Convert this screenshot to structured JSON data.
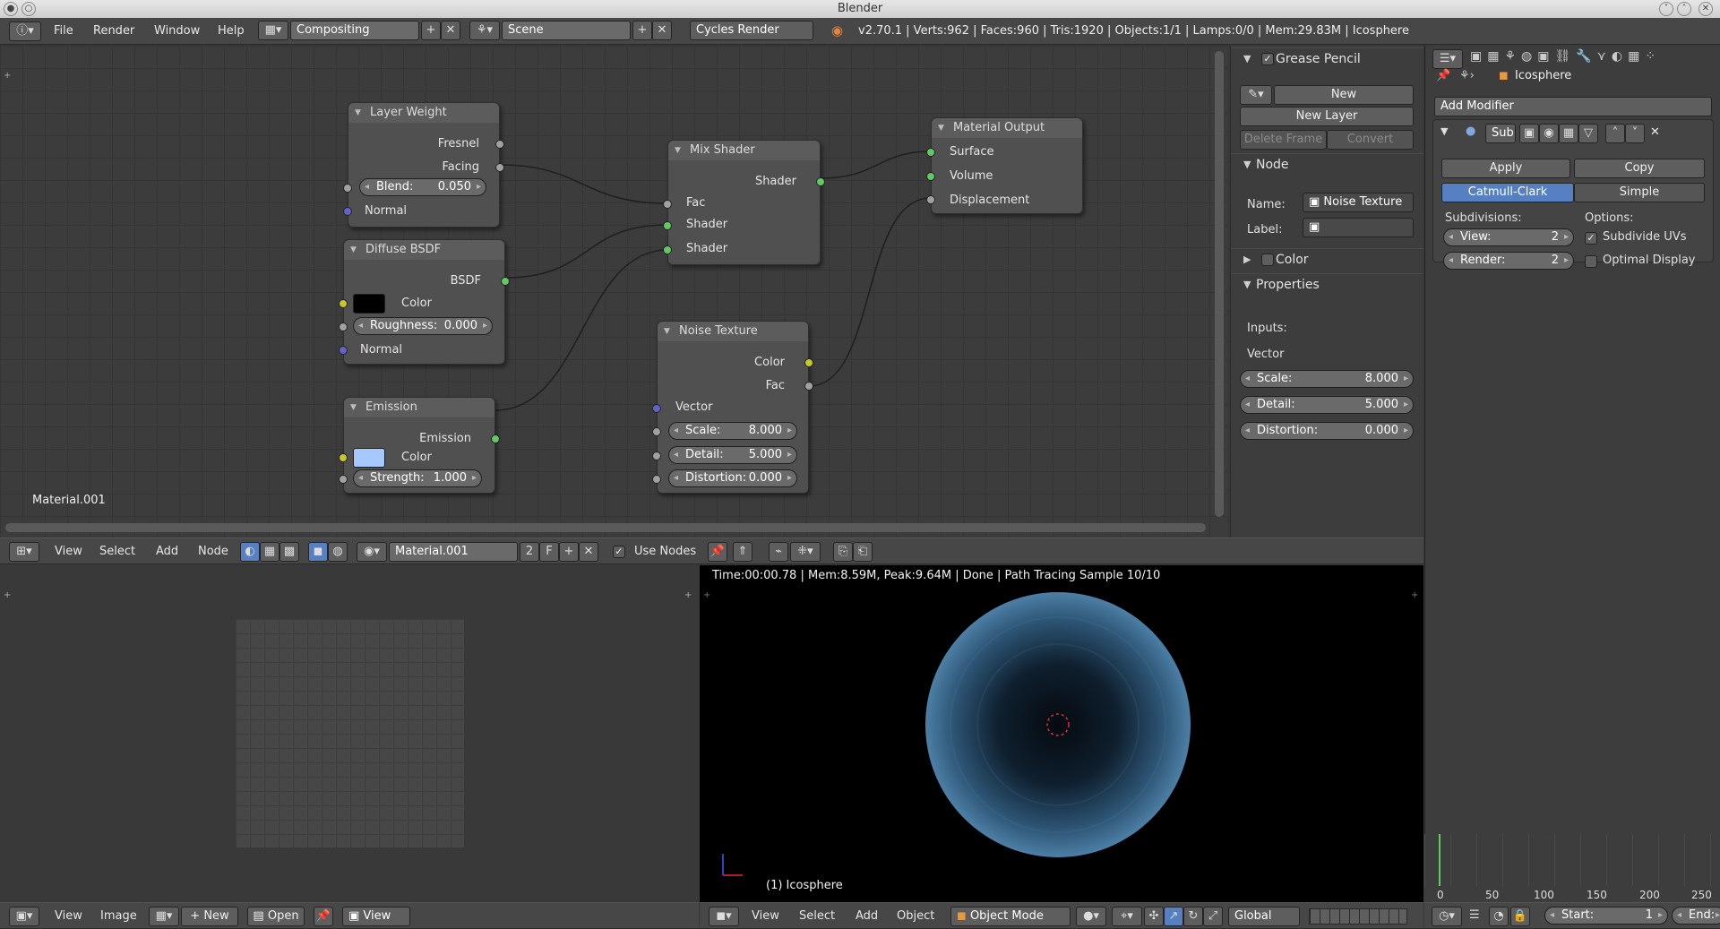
{
  "window": {
    "title": "Blender"
  },
  "topbar": {
    "menus": [
      "File",
      "Render",
      "Window",
      "Help"
    ],
    "screen_layout": "Compositing",
    "scene": "Scene",
    "render_engine": "Cycles Render",
    "stats": "v2.70.1 | Verts:962 | Faces:960 | Tris:1920 | Objects:1/1 | Lamps:0/0 | Mem:29.83M | Icosphere"
  },
  "node_editor": {
    "material_label": "Material.001",
    "nodes": {
      "layer_weight": {
        "title": "Layer Weight",
        "out1": "Fresnel",
        "out2": "Facing",
        "blend_label": "Blend:",
        "blend_value": "0.050",
        "in_normal": "Normal"
      },
      "diffuse": {
        "title": "Diffuse BSDF",
        "out": "BSDF",
        "color_label": "Color",
        "color": "#000000",
        "rough_label": "Roughness:",
        "rough_value": "0.000",
        "in_normal": "Normal"
      },
      "emission": {
        "title": "Emission",
        "out": "Emission",
        "color_label": "Color",
        "color": "#a5c8ff",
        "strength_label": "Strength:",
        "strength_value": "1.000"
      },
      "mix": {
        "title": "Mix Shader",
        "out": "Shader",
        "in_fac": "Fac",
        "in1": "Shader",
        "in2": "Shader"
      },
      "noise": {
        "title": "Noise Texture",
        "out_color": "Color",
        "out_fac": "Fac",
        "in_vector": "Vector",
        "scale_label": "Scale:",
        "scale_value": "8.000",
        "detail_label": "Detail:",
        "detail_value": "5.000",
        "distortion_label": "Distortion:",
        "distortion_value": "0.000"
      },
      "output": {
        "title": "Material Output",
        "in_surface": "Surface",
        "in_volume": "Volume",
        "in_displacement": "Displacement"
      }
    }
  },
  "node_props": {
    "grease_pencil": "Grease Pencil",
    "new": "New",
    "new_layer": "New Layer",
    "delete_frame": "Delete Frame",
    "convert": "Convert",
    "node_section": "Node",
    "name_label": "Name:",
    "name_value": "Noise Texture",
    "label_label": "Label:",
    "color_section": "Color",
    "properties_section": "Properties",
    "inputs": "Inputs:",
    "vector": "Vector",
    "scale_label": "Scale:",
    "scale_value": "8.000",
    "detail_label": "Detail:",
    "detail_value": "5.000",
    "distortion_label": "Distortion:",
    "distortion_value": "0.000"
  },
  "node_header": {
    "menus": [
      "View",
      "Select",
      "Add",
      "Node"
    ],
    "material": "Material.001",
    "users": "2",
    "fake": "F",
    "use_nodes": "Use Nodes"
  },
  "modifiers": {
    "object": "Icosphere",
    "add_modifier": "Add Modifier",
    "mod_name": "Sub",
    "apply": "Apply",
    "copy": "Copy",
    "catmull": "Catmull-Clark",
    "simple": "Simple",
    "subdivisions": "Subdivisions:",
    "options": "Options:",
    "view_label": "View:",
    "view_value": "2",
    "render_label": "Render:",
    "render_value": "2",
    "subdivide_uvs": "Subdivide UVs",
    "optimal_display": "Optimal Display"
  },
  "image_header": {
    "menus": [
      "View",
      "Image"
    ],
    "new": "New",
    "open": "Open",
    "view": "View"
  },
  "viewport": {
    "render_info": "Time:00:00.78 | Mem:8.59M, Peak:9.64M | Done | Path Tracing Sample 10/10",
    "object_label": "(1) Icosphere",
    "menus": [
      "View",
      "Select",
      "Add",
      "Object"
    ],
    "mode": "Object Mode",
    "orientation": "Global"
  },
  "timeline": {
    "ticks": [
      "0",
      "50",
      "100",
      "150",
      "200",
      "250"
    ],
    "start_label": "Start:",
    "start_value": "1",
    "end_label": "End:"
  }
}
